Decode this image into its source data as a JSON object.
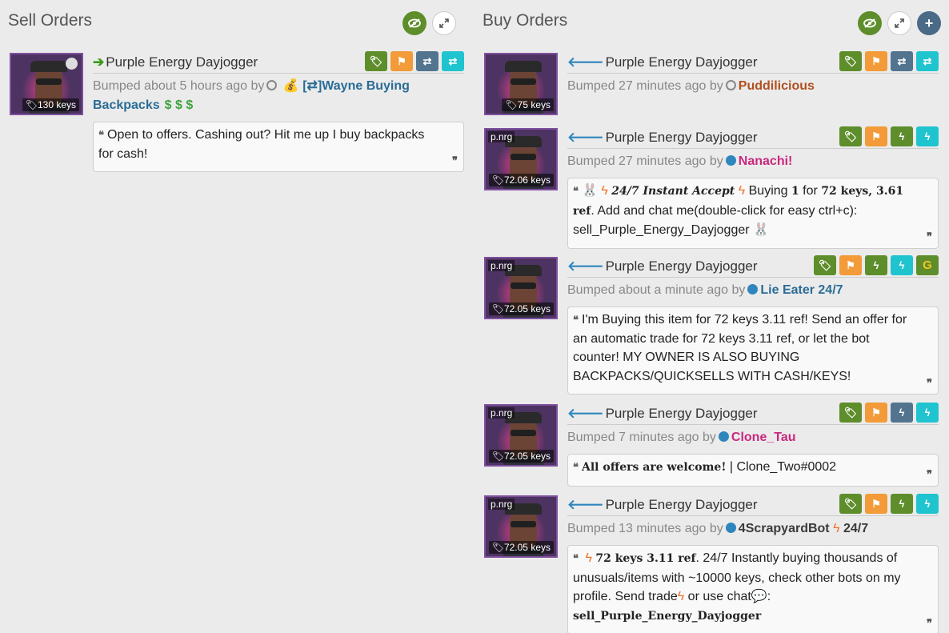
{
  "sell": {
    "title": "Sell Orders",
    "listing": {
      "price": "130 keys",
      "item_name": "Purple Energy Dayjogger",
      "bump_prefix": "Bumped about 5 hours ago by",
      "user_emoji": "💰",
      "user": "[⇄]Wayne Buying Backpacks",
      "user_suffix": "$ $ $",
      "comment": "Open to offers. Cashing out? Hit me up I buy backpacks for cash!"
    }
  },
  "buy": {
    "title": "Buy Orders",
    "listings": [
      {
        "tag": "",
        "price": "75 keys",
        "item_name": "Purple Energy Dayjogger",
        "bump_prefix": "Bumped 27 minutes ago by",
        "user": "Puddilicious"
      },
      {
        "tag": "p.nrg",
        "price": "72.06 keys",
        "item_name": "Purple Energy Dayjogger",
        "bump_prefix": "Bumped 27 minutes ago by",
        "user": "Nanachi!",
        "comment_a": "🐰 ",
        "comment_b": "24/7 Instant Accept",
        "comment_c": " Buying ",
        "comment_d": "1",
        "comment_e": " for ",
        "comment_f": "72 keys, 3.61 ref",
        "comment_g": ". Add and chat me(double-click for easy ctrl+c): sell_Purple_Energy_Dayjogger 🐰"
      },
      {
        "tag": "p.nrg",
        "price": "72.05 keys",
        "item_name": "Purple Energy Dayjogger",
        "bump_prefix": "Bumped about a minute ago by",
        "user": "Lie Eater 24/7",
        "comment": "I'm Buying this item for 72 keys 3.11 ref! Send an offer for an automatic trade for 72 keys 3.11 ref, or let the bot counter! MY OWNER IS ALSO BUYING BACKPACKS/QUICKSELLS WITH CASH/KEYS!"
      },
      {
        "tag": "p.nrg",
        "price": "72.05 keys",
        "item_name": "Purple Energy Dayjogger",
        "bump_prefix": "Bumped 7 minutes ago by",
        "user": "Clone_Tau",
        "comment_a": "All offers are welcome!",
        "comment_b": " | Clone_Two#0002"
      },
      {
        "tag": "p.nrg",
        "price": "72.05 keys",
        "item_name": "Purple Energy Dayjogger",
        "bump_prefix": "Bumped 13 minutes ago by",
        "user": "4ScrapyardBot",
        "user_suffix": "24/7",
        "comment_a": "72 keys 3.11 ref",
        "comment_b": ". 24/7 Instantly buying thousands of unusuals/items with ~10000 keys, check other bots on my profile. Send  trade",
        "comment_c": " or  use  chat",
        "comment_d": "💬",
        "comment_e": ":",
        "comment_f": "sell_Purple_Energy_Dayjogger"
      }
    ]
  },
  "icons": {
    "eye": "eye-slash-icon",
    "expand": "expand-icon",
    "plus": "plus-icon",
    "tag": "tag-icon",
    "flag": "flag-icon",
    "trade": "exchange-icon",
    "bolt": "lightning-icon",
    "quote": "quote-icon"
  },
  "colors": {
    "green": "#5e8d2b",
    "orange": "#f29b38",
    "slate": "#52748f",
    "cyan": "#1fc4cf",
    "user_blue": "#2a6c96",
    "user_brown": "#b0501e",
    "user_pink": "#c9287e"
  }
}
